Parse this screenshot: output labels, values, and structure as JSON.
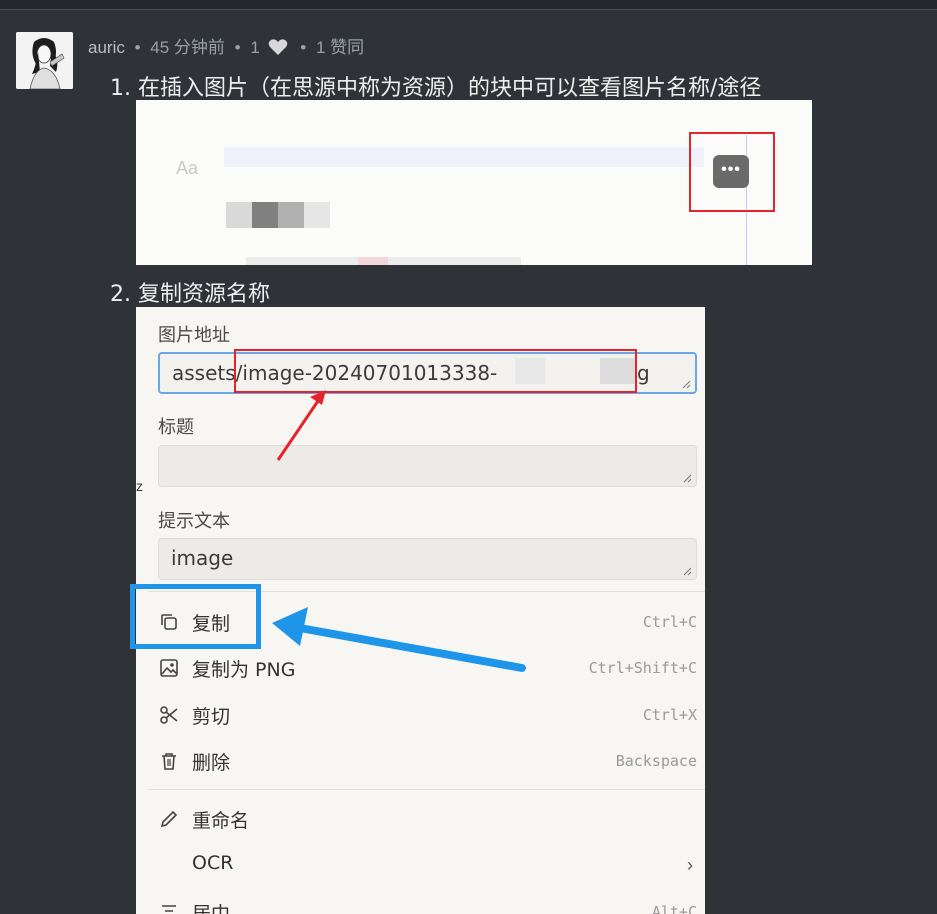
{
  "post": {
    "author": "auric",
    "time": "45 分钟前",
    "likes": "1",
    "agree": "1 赞同"
  },
  "steps": [
    "1. 在插入图片（在思源中称为资源）的块中可以查看图片名称/途径",
    "2. 复制资源名称"
  ],
  "shot1": {
    "aa": "Aa",
    "more_button": "•••"
  },
  "shot2": {
    "edge_glyph": "z",
    "fields": [
      {
        "label": "图片地址",
        "value": "assets/image-20240701013338-",
        "tail": "g"
      },
      {
        "label": "标题",
        "value": ""
      },
      {
        "label": "提示文本",
        "value": "image"
      }
    ],
    "menu": [
      {
        "label": "复制",
        "shortcut": "Ctrl+C",
        "icon": "copy-icon"
      },
      {
        "label": "复制为 PNG",
        "shortcut": "Ctrl+Shift+C",
        "icon": "image-icon"
      },
      {
        "label": "剪切",
        "shortcut": "Ctrl+X",
        "icon": "scissors-icon"
      },
      {
        "label": "删除",
        "shortcut": "Backspace",
        "icon": "trash-icon"
      },
      {
        "label": "重命名",
        "shortcut": "",
        "icon": "pencil-icon"
      },
      {
        "label": "OCR",
        "shortcut": "",
        "icon": "",
        "submenu": "›"
      },
      {
        "label": "居中",
        "shortcut": "Alt+C",
        "icon": "align-center-icon"
      }
    ]
  },
  "colors": {
    "page_bg": "#2f3237",
    "red_annotation": "#e3252b",
    "blue_annotation": "#1f95ea"
  }
}
